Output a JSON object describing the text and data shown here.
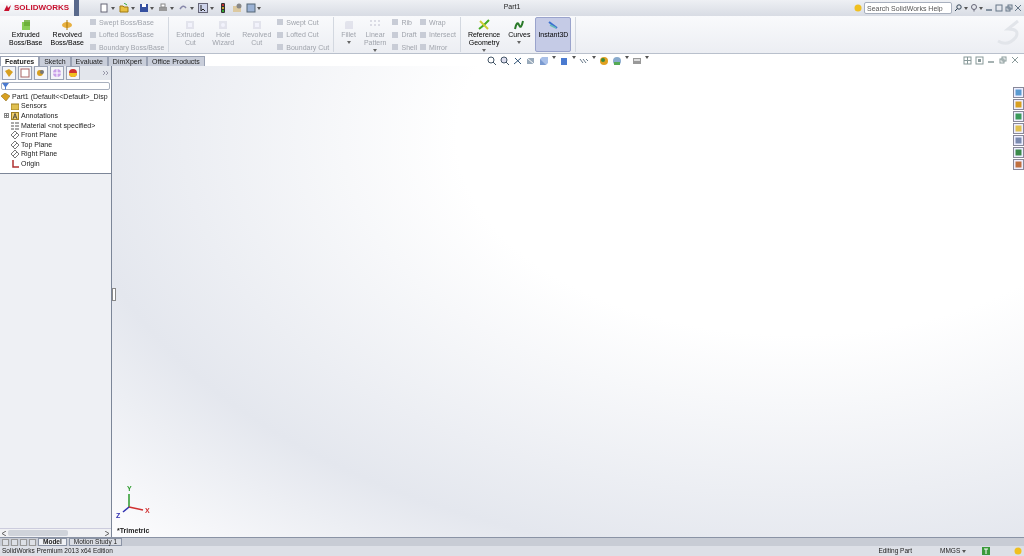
{
  "title_bar": {
    "logo": "SOLIDWORKS",
    "document_title": "Part1",
    "search": {
      "placeholder": "Search SolidWorks Help"
    }
  },
  "ribbon": {
    "groups": [
      {
        "items": [
          {
            "kind": "large",
            "label": "Extruded\nBoss/Base",
            "disabled": false,
            "dropdown": false,
            "selected": false
          },
          {
            "kind": "large",
            "label": "Revolved\nBoss/Base",
            "disabled": false,
            "dropdown": false,
            "selected": false
          },
          {
            "kind": "stack",
            "items": [
              {
                "label": "Swept Boss/Base",
                "disabled": true
              },
              {
                "label": "Lofted Boss/Base",
                "disabled": true
              },
              {
                "label": "Boundary Boss/Base",
                "disabled": true
              }
            ]
          }
        ]
      },
      {
        "items": [
          {
            "kind": "large",
            "label": "Extruded\nCut",
            "disabled": true,
            "dropdown": false,
            "selected": false
          },
          {
            "kind": "large",
            "label": "Hole\nWizard",
            "disabled": true,
            "dropdown": false,
            "selected": false
          },
          {
            "kind": "large",
            "label": "Revolved\nCut",
            "disabled": true,
            "dropdown": false,
            "selected": false
          },
          {
            "kind": "stack",
            "items": [
              {
                "label": "Swept Cut",
                "disabled": true
              },
              {
                "label": "Lofted Cut",
                "disabled": true
              },
              {
                "label": "Boundary Cut",
                "disabled": true
              }
            ]
          }
        ]
      },
      {
        "items": [
          {
            "kind": "large",
            "label": "Fillet",
            "disabled": true,
            "dropdown": true,
            "selected": false
          },
          {
            "kind": "large",
            "label": "Linear\nPattern",
            "disabled": true,
            "dropdown": true,
            "selected": false
          },
          {
            "kind": "stack",
            "items": [
              {
                "label": "Rib",
                "disabled": true
              },
              {
                "label": "Draft",
                "disabled": true
              },
              {
                "label": "Shell",
                "disabled": true
              }
            ]
          },
          {
            "kind": "stack",
            "items": [
              {
                "label": "Wrap",
                "disabled": true
              },
              {
                "label": "Intersect",
                "disabled": true
              },
              {
                "label": "Mirror",
                "disabled": true
              }
            ]
          }
        ]
      },
      {
        "items": [
          {
            "kind": "large",
            "label": "Reference\nGeometry",
            "disabled": false,
            "dropdown": true,
            "selected": false
          },
          {
            "kind": "large",
            "label": "Curves",
            "disabled": false,
            "dropdown": true,
            "selected": false
          },
          {
            "kind": "large",
            "label": "Instant3D",
            "disabled": false,
            "dropdown": false,
            "selected": true
          }
        ]
      }
    ]
  },
  "command_tabs": [
    {
      "label": "Features",
      "selected": true
    },
    {
      "label": "Sketch",
      "selected": false
    },
    {
      "label": "Evaluate",
      "selected": false
    },
    {
      "label": "DimXpert",
      "selected": false
    },
    {
      "label": "Office Products",
      "selected": false
    }
  ],
  "feature_tree": {
    "root": {
      "label": "Part1  (Default<<Default>_Disp",
      "children": [
        {
          "label": "Sensors",
          "kind": "sensors",
          "expander": false
        },
        {
          "label": "Annotations",
          "kind": "annotations",
          "expander": true
        },
        {
          "label": "Material <not specified>",
          "kind": "material",
          "expander": false
        },
        {
          "label": "Front Plane",
          "kind": "plane",
          "expander": false
        },
        {
          "label": "Top Plane",
          "kind": "plane",
          "expander": false
        },
        {
          "label": "Right Plane",
          "kind": "plane",
          "expander": false
        },
        {
          "label": "Origin",
          "kind": "origin",
          "expander": false
        }
      ]
    }
  },
  "viewport": {
    "view_name": "*Trimetric",
    "triad": {
      "x": "X",
      "y": "Y",
      "z": "Z"
    }
  },
  "bottom_tabs": [
    {
      "label": "Model",
      "selected": true
    },
    {
      "label": "Motion Study 1",
      "selected": false
    }
  ],
  "status_bar": {
    "edition": "SolidWorks Premium 2013 x64 Edition",
    "mode": "Editing Part",
    "units": "MMGS"
  }
}
